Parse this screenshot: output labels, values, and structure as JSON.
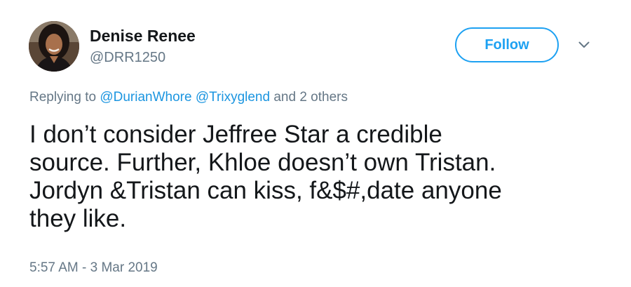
{
  "author": {
    "display_name": "Denise Renee",
    "screen_name": "@DRR1250"
  },
  "actions": {
    "follow_label": "Follow",
    "more_icon": "chevron-down-icon"
  },
  "reply_context": {
    "prefix": "Replying to",
    "mentions": [
      "@DurianWhore",
      "@Trixyglend"
    ],
    "suffix": "and 2 others"
  },
  "tweet": {
    "lines": [
      "I don’t consider Jeffree Star a credible",
      "source. Further, Khloe doesn’t own Tristan.",
      "Jordyn &Tristan can kiss, f&$#,date anyone",
      "they like."
    ],
    "timestamp": "5:57 AM - 3 Mar 2019"
  },
  "colors": {
    "accent": "#1da1f2",
    "mention": "#1b95e0",
    "secondary_text": "#657786",
    "primary_text": "#14171a"
  }
}
